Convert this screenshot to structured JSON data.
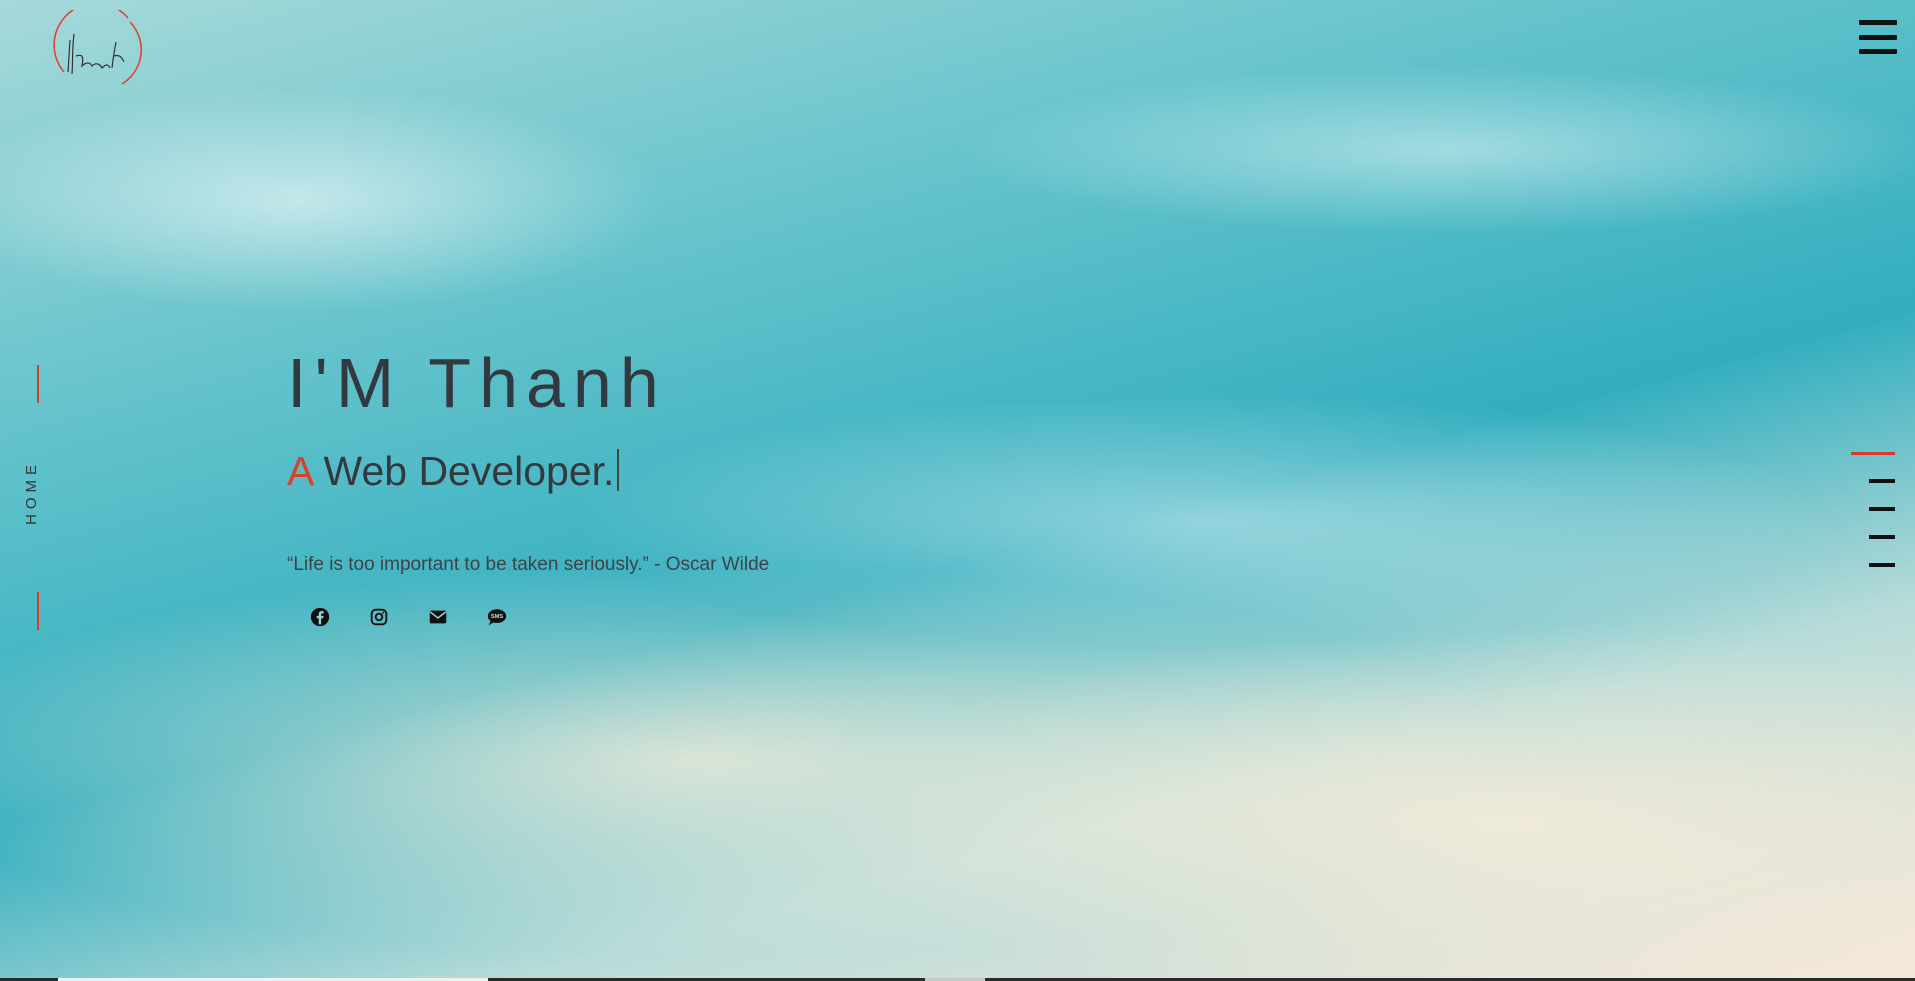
{
  "hero": {
    "greeting": "I'M Thanh",
    "subtitle_accent": "A",
    "subtitle_rest": " Web Developer.",
    "quote": "“Life is too important to be taken seriously.” - Oscar Wilde"
  },
  "sidebar": {
    "section_label": "HOME"
  },
  "socials": [
    {
      "name": "facebook",
      "icon": "facebook-icon"
    },
    {
      "name": "instagram",
      "icon": "instagram-icon"
    },
    {
      "name": "email",
      "icon": "envelope-icon"
    },
    {
      "name": "sms",
      "icon": "sms-icon",
      "icon_text": "SMS"
    }
  ],
  "section_nav": {
    "count": 5,
    "active_index": 0
  },
  "colors": {
    "accent": "#d93a2b",
    "text": "#333a3f",
    "icon": "#111111"
  }
}
